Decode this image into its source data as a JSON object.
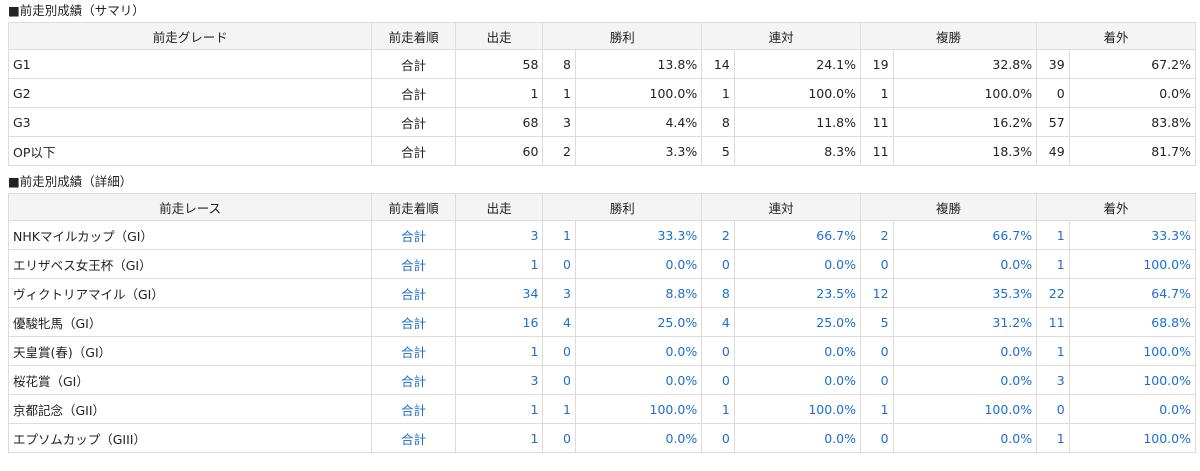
{
  "summary": {
    "title": "■前走別成績（サマリ）",
    "headers": {
      "name": "前走グレード",
      "pos": "前走着順",
      "runs": "出走",
      "win": "勝利",
      "ren": "連対",
      "fuku": "複勝",
      "out": "着外"
    },
    "rows": [
      {
        "name": "G1",
        "pos": "合計",
        "runs": "58",
        "win_n": "8",
        "win_p": "13.8%",
        "ren_n": "14",
        "ren_p": "24.1%",
        "fuku_n": "19",
        "fuku_p": "32.8%",
        "out_n": "39",
        "out_p": "67.2%"
      },
      {
        "name": "G2",
        "pos": "合計",
        "runs": "1",
        "win_n": "1",
        "win_p": "100.0%",
        "ren_n": "1",
        "ren_p": "100.0%",
        "fuku_n": "1",
        "fuku_p": "100.0%",
        "out_n": "0",
        "out_p": "0.0%"
      },
      {
        "name": "G3",
        "pos": "合計",
        "runs": "68",
        "win_n": "3",
        "win_p": "4.4%",
        "ren_n": "8",
        "ren_p": "11.8%",
        "fuku_n": "11",
        "fuku_p": "16.2%",
        "out_n": "57",
        "out_p": "83.8%"
      },
      {
        "name": "OP以下",
        "pos": "合計",
        "runs": "60",
        "win_n": "2",
        "win_p": "3.3%",
        "ren_n": "5",
        "ren_p": "8.3%",
        "fuku_n": "11",
        "fuku_p": "18.3%",
        "out_n": "49",
        "out_p": "81.7%"
      }
    ]
  },
  "detail": {
    "title": "■前走別成績（詳細）",
    "headers": {
      "name": "前走レース",
      "pos": "前走着順",
      "runs": "出走",
      "win": "勝利",
      "ren": "連対",
      "fuku": "複勝",
      "out": "着外"
    },
    "rows": [
      {
        "name": "NHKマイルカップ（GI）",
        "pos": "合計",
        "runs": "3",
        "win_n": "1",
        "win_p": "33.3%",
        "ren_n": "2",
        "ren_p": "66.7%",
        "fuku_n": "2",
        "fuku_p": "66.7%",
        "out_n": "1",
        "out_p": "33.3%"
      },
      {
        "name": "エリザベス女王杯（GI）",
        "pos": "合計",
        "runs": "1",
        "win_n": "0",
        "win_p": "0.0%",
        "ren_n": "0",
        "ren_p": "0.0%",
        "fuku_n": "0",
        "fuku_p": "0.0%",
        "out_n": "1",
        "out_p": "100.0%"
      },
      {
        "name": "ヴィクトリアマイル（GI）",
        "pos": "合計",
        "runs": "34",
        "win_n": "3",
        "win_p": "8.8%",
        "ren_n": "8",
        "ren_p": "23.5%",
        "fuku_n": "12",
        "fuku_p": "35.3%",
        "out_n": "22",
        "out_p": "64.7%"
      },
      {
        "name": "優駿牝馬（GI）",
        "pos": "合計",
        "runs": "16",
        "win_n": "4",
        "win_p": "25.0%",
        "ren_n": "4",
        "ren_p": "25.0%",
        "fuku_n": "5",
        "fuku_p": "31.2%",
        "out_n": "11",
        "out_p": "68.8%"
      },
      {
        "name": "天皇賞(春)（GI）",
        "pos": "合計",
        "runs": "1",
        "win_n": "0",
        "win_p": "0.0%",
        "ren_n": "0",
        "ren_p": "0.0%",
        "fuku_n": "0",
        "fuku_p": "0.0%",
        "out_n": "1",
        "out_p": "100.0%"
      },
      {
        "name": "桜花賞（GI）",
        "pos": "合計",
        "runs": "3",
        "win_n": "0",
        "win_p": "0.0%",
        "ren_n": "0",
        "ren_p": "0.0%",
        "fuku_n": "0",
        "fuku_p": "0.0%",
        "out_n": "3",
        "out_p": "100.0%"
      },
      {
        "name": "京都記念（GII）",
        "pos": "合計",
        "runs": "1",
        "win_n": "1",
        "win_p": "100.0%",
        "ren_n": "1",
        "ren_p": "100.0%",
        "fuku_n": "1",
        "fuku_p": "100.0%",
        "out_n": "0",
        "out_p": "0.0%"
      },
      {
        "name": "エプソムカップ（GIII）",
        "pos": "合計",
        "runs": "1",
        "win_n": "0",
        "win_p": "0.0%",
        "ren_n": "0",
        "ren_p": "0.0%",
        "fuku_n": "0",
        "fuku_p": "0.0%",
        "out_n": "1",
        "out_p": "100.0%"
      }
    ]
  },
  "colors": {
    "link": "#1a6fd1",
    "header_bg": "#f4f4f4",
    "border": "#dcdcdc"
  }
}
